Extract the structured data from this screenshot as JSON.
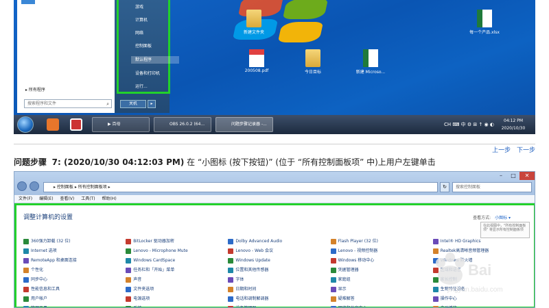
{
  "desktop": {
    "start_menu": {
      "right_items": [
        "游戏",
        "计算机",
        "网络",
        "控制面板",
        "设备和打印机",
        "默认程序",
        "运行..."
      ],
      "all_programs": "所有程序",
      "search_placeholder": "搜索程序和文件",
      "shutdown_label": "关机",
      "shutdown_arrow": "▸"
    },
    "icons": [
      {
        "label": "新建文件夹",
        "type": "folder"
      },
      {
        "label": "200508.pdf",
        "type": "pdf"
      },
      {
        "label": "今日目标",
        "type": "folder"
      },
      {
        "label": "新建 Microso...",
        "type": "xlsx"
      },
      {
        "label": "每一个产品.xlsx",
        "type": "xlsx"
      }
    ],
    "taskbar": {
      "buttons": [
        "▶ 百母",
        "OBS 26.0.2 (64...",
        "问题步骤记录器 -..."
      ],
      "tray": "CH ⌨ 中 ⚙ ⊞ ↑ ◉ ◐",
      "time": "04:12 PM",
      "date": "2020/10/30"
    }
  },
  "nav": {
    "prev": "上一步",
    "next": "下一步"
  },
  "step": {
    "prefix": "问题步骤",
    "number_time": "7: (2020/10/30 04:12:03 PM)",
    "text": "在 “小图标 (按下按钮)” (位于 “所有控制面板项” 中)上用户左键单击"
  },
  "control_panel": {
    "breadcrumb": "▸ 控制面板 ▸ 所有控制面板项 ▸",
    "search_placeholder": "搜索控制面板",
    "menubar": [
      "文件(F)",
      "编辑(E)",
      "查看(V)",
      "工具(T)",
      "帮助(H)"
    ],
    "heading": "调整计算机的设置",
    "viewby_label": "查看方式:",
    "viewby_value": "小图标 ▾",
    "tooltip": "在此视图中，\"所有控制面板项\" 将显示所有控制面板项",
    "items": [
      "360强力卸载 (32 位)",
      "BitLocker 驱动器加密",
      "Dolby Advanced Audio",
      "Flash Player (32 位)",
      "Intel® HD Graphics",
      "Internet 选项",
      "Lenovo - Microphone Mute",
      "Lenovo - Web 会议",
      "Lenovo - 视频控制器",
      "Realtek高清晰音频管理器",
      "RemoteApp 和桌面连接",
      "Windows CardSpace",
      "Windows Update",
      "Windows 移动中心",
      "Windows 防火墙",
      "个性化",
      "任务栏和「开始」菜单",
      "位置和其他传感器",
      "凭据管理器",
      "区域和语言",
      "同步中心",
      "声音",
      "字体",
      "家庭组",
      "家长控制",
      "性能信息和工具",
      "文件夹选项",
      "日期和时间",
      "显示",
      "生物特征设备",
      "用户帐户",
      "电源选项",
      "电话和调制解调器",
      "疑难解答",
      "操作中心",
      "管理工具",
      "系统",
      "设备管理器",
      "网络和共享中心",
      "自动播放"
    ]
  },
  "colors": {
    "highlight_green": "#22d12b",
    "link_blue": "#2060c0",
    "desktop_blue": "#0a55b3"
  }
}
